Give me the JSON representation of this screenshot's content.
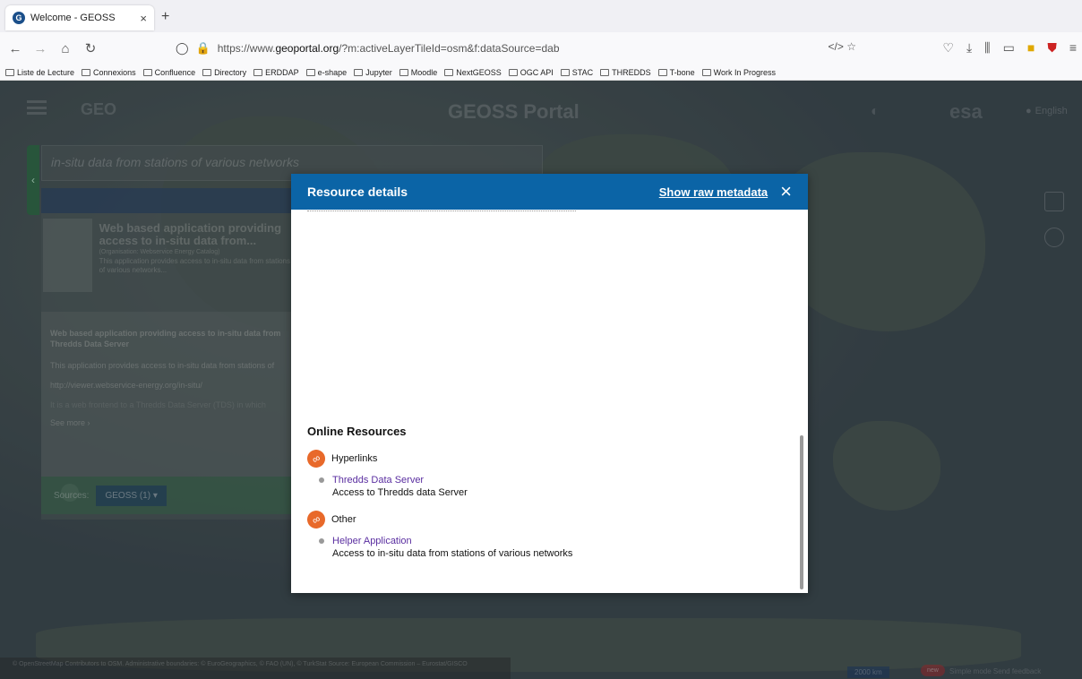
{
  "browser": {
    "tab_title": "Welcome - GEOSS",
    "tab_close": "×",
    "new_tab": "+",
    "url_prefix": "https://www.",
    "url_domain": "geoportal.org",
    "url_path": "/?m:activeLayerTileId=osm&f:dataSource=dab",
    "bookmarks": [
      "Liste de Lecture",
      "Connexions",
      "Confluence",
      "Directory",
      "ERDDAP",
      "e-shape",
      "Jupyter",
      "Moodle",
      "NextGEOSS",
      "OGC API",
      "STAC",
      "THREDDS",
      "T-bone",
      "Work In Progress"
    ]
  },
  "portal": {
    "geo_logo": "GEO",
    "title": "GEOSS Portal",
    "esa_logo": "esa",
    "language": "English",
    "search_text": "in-situ data from stations of various networks",
    "result": {
      "title": "Web based application providing access to in-situ data from...",
      "org": "(Organisation: Webservice Energy Catalog)",
      "desc": "This application provides access to in-situ data from stations of various networks..."
    },
    "detail": {
      "title": "Web based application providing access to in-situ data from Thredds Data Server",
      "desc": "This application provides access to in-situ data from stations of",
      "url": "http://viewer.webservice-energy.org/in-situ/",
      "faded": "It is a web frontend to a Thredds Data Server (TDS) in which",
      "see_more": "See more"
    },
    "sources_label": "Sources:",
    "sources_value": "GEOSS (1)",
    "attribution": "© OpenStreetMap Contributors to OSM. Administrative boundaries: © EuroGeographics, © FAO (UN), © TurkStat Source: European Commission – Eurostat/GISCO",
    "scale": "2000 km",
    "new_badge": "new",
    "bottom_links": "Simple mode   Send feedback"
  },
  "modal": {
    "title": "Resource details",
    "raw_link": "Show raw metadata",
    "close": "×",
    "online_resources": "Online Resources",
    "groups": [
      {
        "title": "Hyperlinks",
        "items": [
          {
            "link": "Thredds Data Server",
            "desc": "Access to Thredds data Server"
          }
        ]
      },
      {
        "title": "Other",
        "items": [
          {
            "link": "Helper Application",
            "desc": "Access to in-situ data from stations of various networks"
          }
        ]
      }
    ]
  }
}
